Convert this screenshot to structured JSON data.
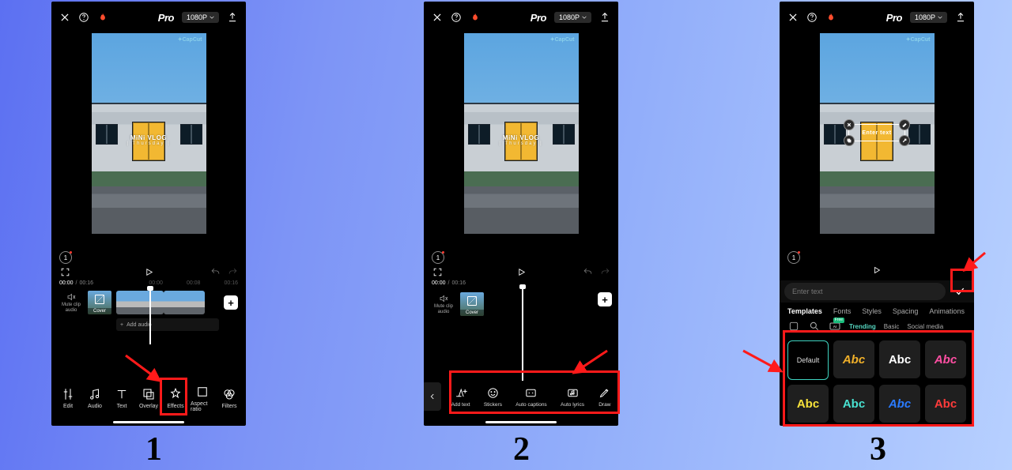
{
  "steps": [
    "1",
    "2",
    "3"
  ],
  "top": {
    "pro": "Pro",
    "resolution": "1080P"
  },
  "preview": {
    "watermark": "CapCut",
    "vlog_title": "MiNi VLOG",
    "vlog_sub": "| Thursday |",
    "edit_text": "Enter text"
  },
  "counter": "1",
  "time": {
    "cur": "00:00",
    "total": "00:16"
  },
  "ticks": [
    "00:00",
    "00:08",
    "00:16"
  ],
  "timeline": {
    "mute": "Mute clip audio",
    "cover": "Cover",
    "add_audio": "Add audio"
  },
  "toolbar1": {
    "edit": "Edit",
    "audio": "Audio",
    "text": "Text",
    "overlay": "Overlay",
    "effects": "Effects",
    "aspect": "Aspect ratio",
    "filters": "Filters"
  },
  "toolbar2": {
    "add": "Add text",
    "stickers": "Stickers",
    "captions": "Auto captions",
    "lyrics": "Auto lyrics",
    "draw": "Draw"
  },
  "panel3": {
    "enter_ph": "Enter text",
    "tabs": {
      "templates": "Templates",
      "fonts": "Fonts",
      "styles": "Styles",
      "spacing": "Spacing",
      "anim": "Animations"
    },
    "sub": {
      "trending": "Trending",
      "basic": "Basic",
      "social": "Social media",
      "badge": "Free"
    },
    "cells": {
      "def": "Default",
      "abc": "Abc"
    }
  }
}
